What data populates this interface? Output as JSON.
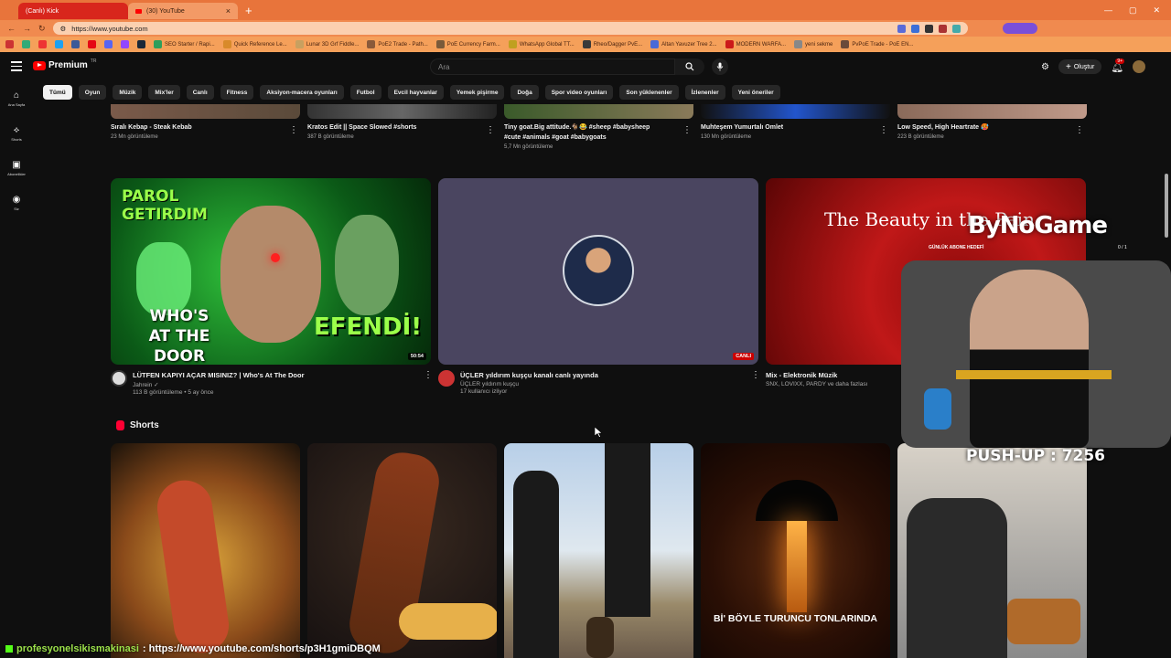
{
  "browser": {
    "tabs": [
      {
        "label": "(Canlı) Kick"
      },
      {
        "label": "(30) YouTube"
      }
    ],
    "url": "https://www.youtube.com",
    "bookmarks": [
      "Gmail",
      "Maps",
      "YouTube",
      "Twitter",
      "Facebook",
      "Netflix",
      "Discord",
      "Twitch",
      "Steam",
      "SEO Starter / Rapi...",
      "Quick Reference Le...",
      "Lunar 3D Grf Fiddle...",
      "PoE2 Trade - Path...",
      "PoE Currency Farm...",
      "WhatsApp Global TT...",
      "Rheo/Dagger PvE...",
      "Altan Yavuzer Tree 2...",
      "MODERN WARFA...",
      "yeni sekme",
      "PvPoE Trade - PoE EN..."
    ]
  },
  "header": {
    "logo_text": "Premium",
    "country_code": "TR",
    "search_placeholder": "Ara",
    "create_label": "Oluştur",
    "notif_count": "9+"
  },
  "guide": [
    {
      "label": "Ana Sayfa",
      "icon": "home-icon"
    },
    {
      "label": "Shorts",
      "icon": "shorts-icon"
    },
    {
      "label": "Abonelikler",
      "icon": "subscriptions-icon"
    },
    {
      "label": "Siz",
      "icon": "you-icon"
    }
  ],
  "chips": [
    "Tümü",
    "Oyun",
    "Müzik",
    "Mix'ler",
    "Canlı",
    "Fitness",
    "Aksiyon-macera oyunları",
    "Futbol",
    "Evcil hayvanlar",
    "Yemek pişirme",
    "Doğa",
    "Spor video oyunları",
    "Son yüklenenler",
    "İzlenenler",
    "Yeni öneriler"
  ],
  "top_shorts": [
    {
      "title": "Sıralı Kebap - Steak Kebab",
      "views": "23 Mn görüntüleme"
    },
    {
      "title": "Kratos Edit || Space Slowed #shorts",
      "views": "387 B görüntüleme"
    },
    {
      "title": "Tiny goat.Big attitude.🐐😂 #sheep #babysheep",
      "title2": "#cute #animals #goat #babygoats",
      "views": "5,7 Mn görüntüleme"
    },
    {
      "title": "Muhteşem Yumurtalı Omlet",
      "views": "130 Mn görüntüleme"
    },
    {
      "title": "Low Speed, High Heartrate 🥵",
      "views": "223 B görüntüleme"
    }
  ],
  "videos": [
    {
      "title": "LÜTFEN KAPIYI AÇAR MISINIZ? | Who's At The Door",
      "channel": "Jahrein ✓",
      "stats": "113 B görüntüleme • 5 ay önce",
      "duration": "50:54",
      "thumb_text_top": "PAROL GETIRDIM",
      "thumb_text_left": "WHO'S AT THE DOOR",
      "thumb_text_right": "EFENDİ!"
    },
    {
      "title": "ÜÇLER yıldırım kuşçu kanalı canlı yayında",
      "channel": "ÜÇLER yıldırım kuşçu",
      "stats": "17 kullanıcı izliyor",
      "live": "CANLI"
    },
    {
      "title": "Mix - Elektronik Müzik",
      "channel": "SNX, LOVIXX, PARDY ve daha fazlası",
      "thumb_text": "The Beauty in the Pain"
    }
  ],
  "shorts_section": {
    "title": "Shorts",
    "thumb4_text": "Bİ' BÖYLE TURUNCU TONLARINDA"
  },
  "overlay": {
    "brand": "ByNoGame",
    "goal_label": "GÜNLÜK ABONE HEDEFİ",
    "goal_count": "0 / 1",
    "pushup": "PUSH-UP : 7256",
    "chat_user": "profesyonelsikismakinasi",
    "chat_msg": ": https://www.youtube.com/shorts/p3H1gmiDBQM"
  },
  "colors": {
    "yt_bg": "#0f0f0f",
    "chip_bg": "#272727",
    "accent_red": "#ff0000",
    "browser_orange": "#e8743b"
  }
}
